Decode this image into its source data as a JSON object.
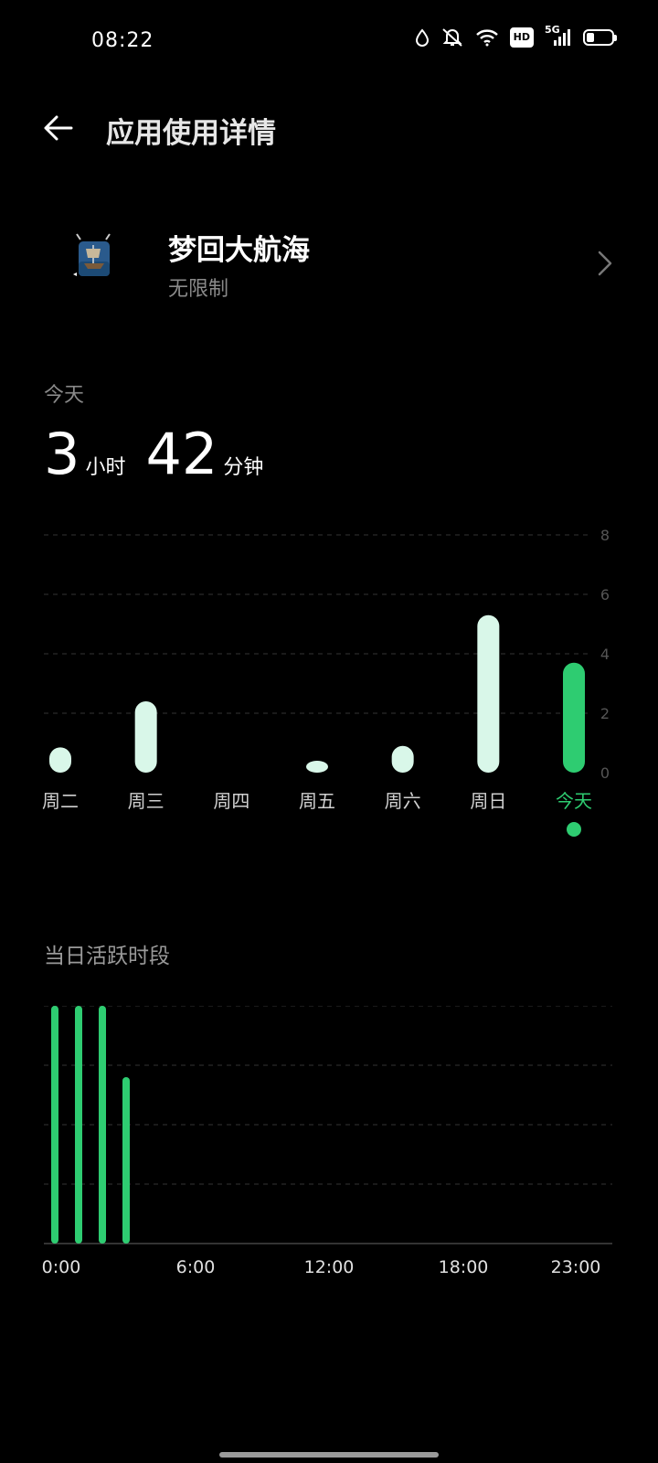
{
  "status": {
    "time": "08:22",
    "icons": [
      "drop-icon",
      "mute-icon",
      "wifi-icon",
      "hd-icon",
      "5g-signal-icon",
      "battery-icon"
    ],
    "hd_label": "HD",
    "network_label": "5G",
    "battery_level": 0.3
  },
  "header": {
    "title": "应用使用详情"
  },
  "app": {
    "name": "梦回大航海",
    "subtitle": "无限制",
    "icon": "ship-icon"
  },
  "today": {
    "label": "今天",
    "hours": "3",
    "hours_unit": "小时",
    "minutes": "42",
    "minutes_unit": "分钟"
  },
  "colors": {
    "accent": "#2ecc71",
    "bar_light": "#d9f7e9",
    "grid": "#333333",
    "muted": "#8a8a8a"
  },
  "section": {
    "active_title": "当日活跃时段"
  },
  "chart_data": [
    {
      "type": "bar",
      "categories": [
        "周二",
        "周三",
        "周四",
        "周五",
        "周六",
        "周日",
        "今天"
      ],
      "values": [
        0.85,
        2.4,
        0,
        0.4,
        0.9,
        5.3,
        3.7
      ],
      "selected_index": 6,
      "ylim": [
        0,
        8
      ],
      "yticks": [
        "0",
        "2",
        "4",
        "6",
        "8"
      ],
      "ytick_values": [
        0,
        2,
        4,
        6,
        8
      ],
      "grid": true
    },
    {
      "type": "bar",
      "x": [
        0,
        1,
        2,
        3
      ],
      "values": [
        1,
        1,
        1,
        0.7
      ],
      "xlim": [
        0,
        23
      ],
      "ylim": [
        0,
        1
      ],
      "xticks": [
        "0:00",
        "6:00",
        "12:00",
        "18:00",
        "23:00"
      ],
      "xtick_values": [
        0,
        6,
        12,
        18,
        23
      ],
      "grid": true
    }
  ]
}
